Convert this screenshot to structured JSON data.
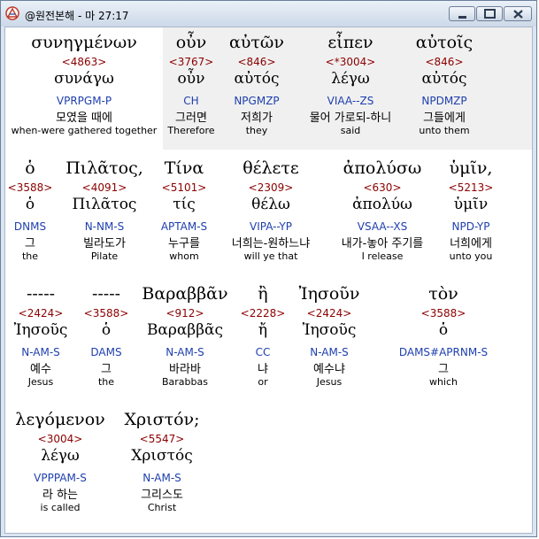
{
  "window": {
    "title": "@원전본해 - 마 27:17"
  },
  "rows": [
    [
      {
        "greek": "συνηγμένων",
        "strongs": "<4863>",
        "lemma": "συνάγω",
        "parsing": "VPRPGM-P",
        "korean": "모였을 때에",
        "english": "when-were gathered together"
      },
      {
        "greek": "οὖν",
        "strongs": "<3767>",
        "lemma": "οὖν",
        "parsing": "CH",
        "korean": "그러면",
        "english": "Therefore"
      },
      {
        "greek": "αὐτῶν",
        "strongs": "<846>",
        "lemma": "αὐτός",
        "parsing": "NPGMZP",
        "korean": "저희가",
        "english": "they"
      },
      {
        "greek": "εἶπεν",
        "strongs": "<*3004>",
        "lemma": "λέγω",
        "parsing": "VIAA--ZS",
        "korean": "물어 가로되-하니",
        "english": "said"
      },
      {
        "greek": "αὐτοῖς",
        "strongs": "<846>",
        "lemma": "αὐτός",
        "parsing": "NPDMZP",
        "korean": "그들에게",
        "english": "unto them"
      }
    ],
    [
      {
        "greek": "ὁ",
        "strongs": "<3588>",
        "lemma": "ὁ",
        "parsing": "DNMS",
        "korean": "그",
        "english": "the"
      },
      {
        "greek": "Πιλᾶτος,",
        "strongs": "<4091>",
        "lemma": "Πιλᾶτος",
        "parsing": "N-NM-S",
        "korean": "빌라도가",
        "english": "Pilate"
      },
      {
        "greek": "Τίνα",
        "strongs": "<5101>",
        "lemma": "τίς",
        "parsing": "APTAM-S",
        "korean": "누구를",
        "english": "whom"
      },
      {
        "greek": "θέλετε",
        "strongs": "<2309>",
        "lemma": "θέλω",
        "parsing": "VIPA--YP",
        "korean": "너희는-원하느냐",
        "english": "will ye that"
      },
      {
        "greek": "ἀπολύσω",
        "strongs": "<630>",
        "lemma": "ἀπολύω",
        "parsing": "VSAA--XS",
        "korean": "내가-놓아 주기를",
        "english": "I release"
      },
      {
        "greek": "ὑμῖν,",
        "strongs": "<5213>",
        "lemma": "ὑμῖν",
        "parsing": "NPD-YP",
        "korean": "너희에게",
        "english": "unto you"
      }
    ],
    [
      {
        "greek": "-----",
        "strongs": "<2424>",
        "lemma": "Ἰησοῦς",
        "parsing": "N-AM-S",
        "korean": "예수",
        "english": "Jesus"
      },
      {
        "greek": "-----",
        "strongs": "<3588>",
        "lemma": "ὁ",
        "parsing": "DAMS",
        "korean": "그",
        "english": "the"
      },
      {
        "greek": "Βαραββᾶν",
        "strongs": "<912>",
        "lemma": "Βαραββᾶς",
        "parsing": "N-AM-S",
        "korean": "바라바",
        "english": "Barabbas"
      },
      {
        "greek": "ἢ",
        "strongs": "<2228>",
        "lemma": "ἤ",
        "parsing": "CC",
        "korean": "냐",
        "english": "or"
      },
      {
        "greek": "Ἰησοῦν",
        "strongs": "<2424>",
        "lemma": "Ἰησοῦς",
        "parsing": "N-AM-S",
        "korean": "예수냐",
        "english": "Jesus"
      },
      {
        "greek": "τὸν",
        "strongs": "<3588>",
        "lemma": "ὁ",
        "parsing": "DAMS#APRNM-S",
        "korean": "그",
        "english": "which"
      }
    ],
    [
      {
        "greek": "λεγόμενον",
        "strongs": "<3004>",
        "lemma": "λέγω",
        "parsing": "VPPPAM-S",
        "korean": "라 하는",
        "english": "is called"
      },
      {
        "greek": "Χριστόν;",
        "strongs": "<5547>",
        "lemma": "Χριστός",
        "parsing": "N-AM-S",
        "korean": "그리스도",
        "english": "Christ"
      }
    ]
  ]
}
